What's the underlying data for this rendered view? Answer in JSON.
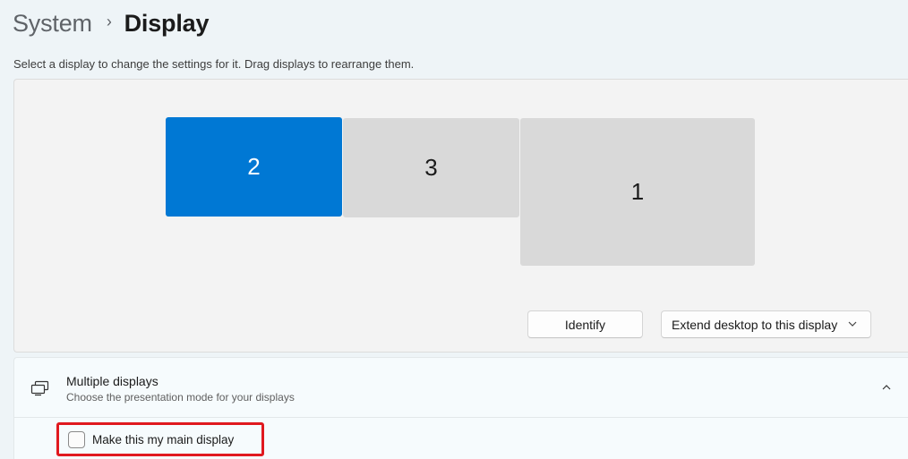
{
  "breadcrumb": {
    "parent": "System",
    "separator": "›",
    "current": "Display"
  },
  "instructions": "Select a display to change the settings for it. Drag displays to rearrange them.",
  "displays": [
    {
      "label": "2",
      "selected": true
    },
    {
      "label": "3",
      "selected": false
    },
    {
      "label": "1",
      "selected": false
    }
  ],
  "actions": {
    "identify_label": "Identify",
    "mode_dropdown_value": "Extend desktop to this display"
  },
  "multiple_displays": {
    "icon": "multiple-monitors-icon",
    "title": "Multiple displays",
    "subtitle": "Choose the presentation mode for your displays",
    "expanded": true,
    "main_display_label": "Make this my main display",
    "main_display_checked": false
  },
  "colors": {
    "accent": "#0078d4",
    "highlight_box": "#e0191f"
  }
}
